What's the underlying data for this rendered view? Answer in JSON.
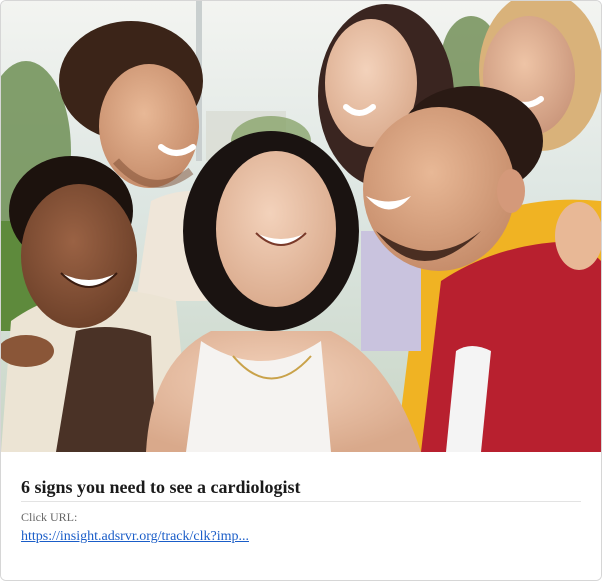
{
  "ad": {
    "image": {
      "description_icon": "photo-group-of-laughing-friends"
    },
    "headline": "6 signs you need to see a cardiologist",
    "click_url_label": "Click URL:",
    "click_url": "https://insight.adsrvr.org/track/clk?imp..."
  },
  "colors": {
    "link": "#1a5dc8",
    "headline": "#1a1a1a",
    "label": "#666666",
    "border": "#d6d6d6"
  }
}
